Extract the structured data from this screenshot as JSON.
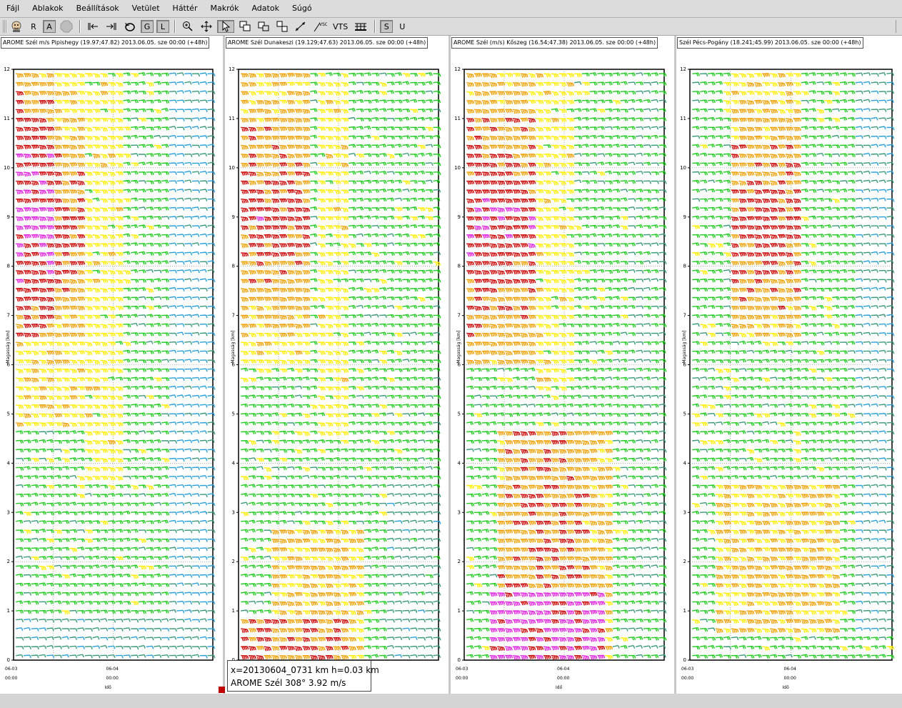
{
  "menu": [
    "Fájl",
    "Ablakok",
    "Beállítások",
    "Vetület",
    "Háttér",
    "Makrók",
    "Adatok",
    "Súgó"
  ],
  "toolbar": {
    "btn_r": "R",
    "btn_a": "A",
    "btn_g": "G",
    "btn_l": "L",
    "btn_vts": "VTS",
    "btn_s": "S",
    "btn_u": "U"
  },
  "axis": {
    "ylabel": "Magasság [km]",
    "xlabel": "Idő",
    "yticks": [
      "0",
      "1",
      "2",
      "3",
      "4",
      "5",
      "6",
      "7",
      "8",
      "9",
      "10",
      "11",
      "12"
    ],
    "xticks": [
      {
        "date": "06-03",
        "time": "00:00"
      },
      {
        "date": "06-04",
        "time": "00:00"
      }
    ]
  },
  "panels": [
    {
      "title": "AROME Szél m/s Pipishegy (19.97;47.82) 2013.06.05. sze 00:00 (+48h)"
    },
    {
      "title": "AROME Szél Dunakeszi (19.129;47.63) 2013.06.05. sze 00:00 (+48h)"
    },
    {
      "title": "AROME Szél (m/s) Kőszeg (16.54;47.38) 2013.06.05. sze 00:00 (+48h)"
    },
    {
      "title": "Szél Pécs-Pogány (18.241;45.99) 2013.06.05. sze 00:00 (+48h)"
    }
  ],
  "chart_data": {
    "type": "wind-barbs",
    "y_range_km": [
      0,
      12
    ],
    "legend_colors": {
      "weak": "#1e6fd6",
      "light": "#2aa0d8",
      "moderate_teal": "#3a9a7a",
      "moderate": "#22cc22",
      "fresh": "#ffee00",
      "strong": "#f0a000",
      "very_strong": "#cc0000",
      "extreme": "#e020e0"
    }
  },
  "tooltip": {
    "line1": "x=20130604_0731 km h=0.03 km",
    "line2": "AROME Szél   308°  3.92 m/s"
  },
  "colors": {
    "background": "#d9d9d9",
    "panel": "#ffffff",
    "marker": "#c00000"
  }
}
